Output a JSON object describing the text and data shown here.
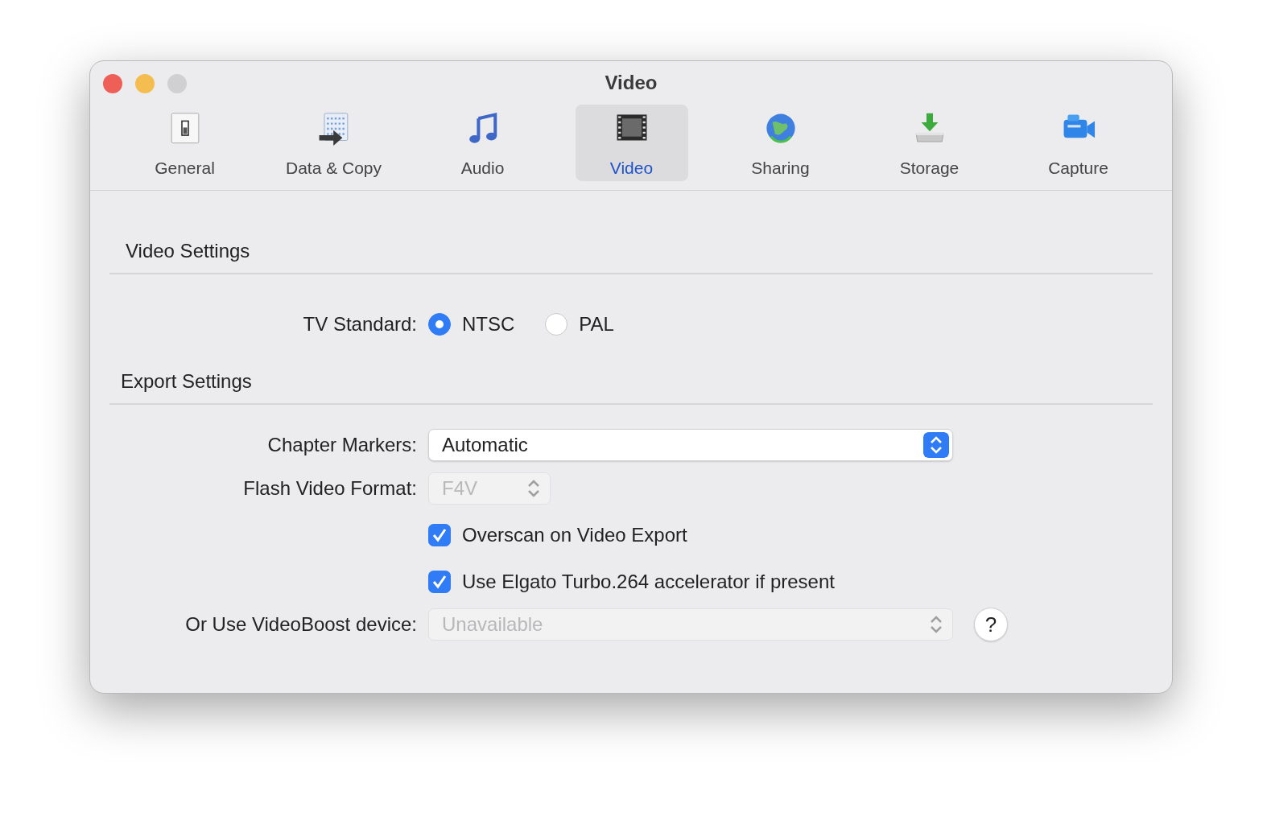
{
  "window": {
    "title": "Video"
  },
  "tabs": [
    {
      "label": "General",
      "selected": false
    },
    {
      "label": "Data & Copy",
      "selected": false
    },
    {
      "label": "Audio",
      "selected": false
    },
    {
      "label": "Video",
      "selected": true
    },
    {
      "label": "Sharing",
      "selected": false
    },
    {
      "label": "Storage",
      "selected": false
    },
    {
      "label": "Capture",
      "selected": false
    }
  ],
  "video_settings": {
    "heading": "Video Settings",
    "tv_standard": {
      "label": "TV Standard:",
      "options": [
        {
          "label": "NTSC",
          "selected": true
        },
        {
          "label": "PAL",
          "selected": false
        }
      ]
    }
  },
  "export_settings": {
    "heading": "Export Settings",
    "chapter_markers": {
      "label": "Chapter Markers:",
      "value": "Automatic",
      "disabled": false
    },
    "flash_video_format": {
      "label": "Flash Video Format:",
      "value": "F4V",
      "disabled": true
    },
    "checkboxes": [
      {
        "label": "Overscan on Video Export",
        "checked": true
      },
      {
        "label": "Use Elgato Turbo.264 accelerator if present",
        "checked": true
      }
    ],
    "videoboost": {
      "label": "Or Use VideoBoost device:",
      "value": "Unavailable",
      "disabled": true
    },
    "help_button": "?"
  }
}
